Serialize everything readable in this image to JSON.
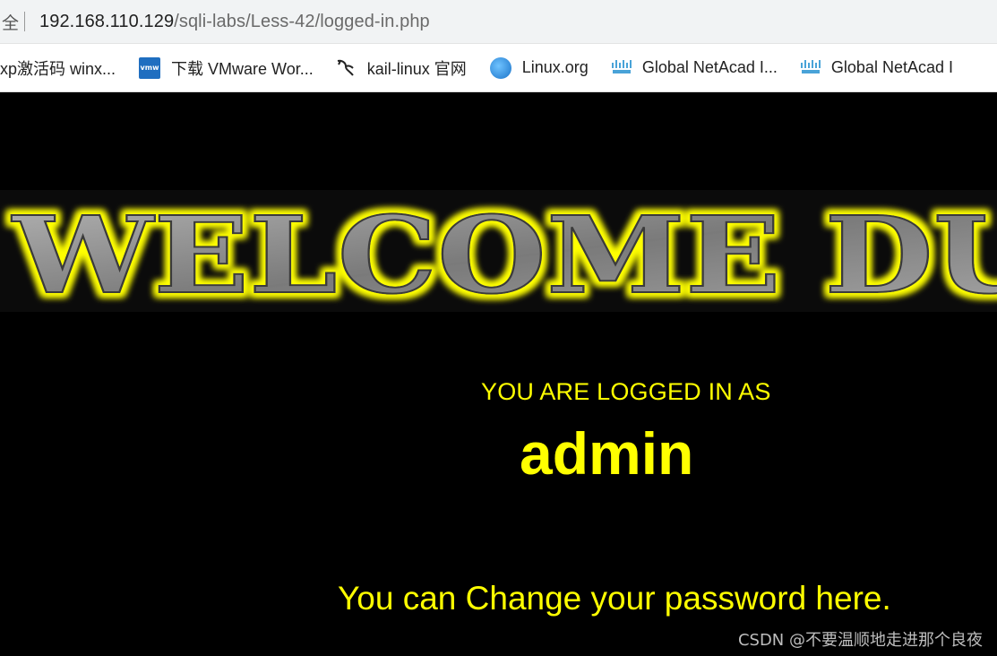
{
  "browser": {
    "security_label": "全",
    "url_host": "192.168.110.129",
    "url_path": "/sqli-labs/Less-42/logged-in.php"
  },
  "bookmarks": [
    {
      "label": "xp激活码 winx...",
      "icon": "none"
    },
    {
      "label": "下载 VMware Wor...",
      "icon": "vmw-icon"
    },
    {
      "label": "kail-linux 官网",
      "icon": "kali-dragon-icon"
    },
    {
      "label": "Linux.org",
      "icon": "globe-icon"
    },
    {
      "label": "Global NetAcad I...",
      "icon": "cisco-icon"
    },
    {
      "label": "Global NetAcad I",
      "icon": "cisco-icon"
    }
  ],
  "banner": {
    "text": "WELCOME DU",
    "text_color": "#8a8a8a",
    "glow_color": "#ffff00"
  },
  "page": {
    "logged_label": "YOU ARE LOGGED IN AS",
    "username": "admin",
    "change_link": "You can Change your password here.",
    "accent_color": "#ffff00"
  },
  "watermark": "CSDN @不要温顺地走进那个良夜"
}
